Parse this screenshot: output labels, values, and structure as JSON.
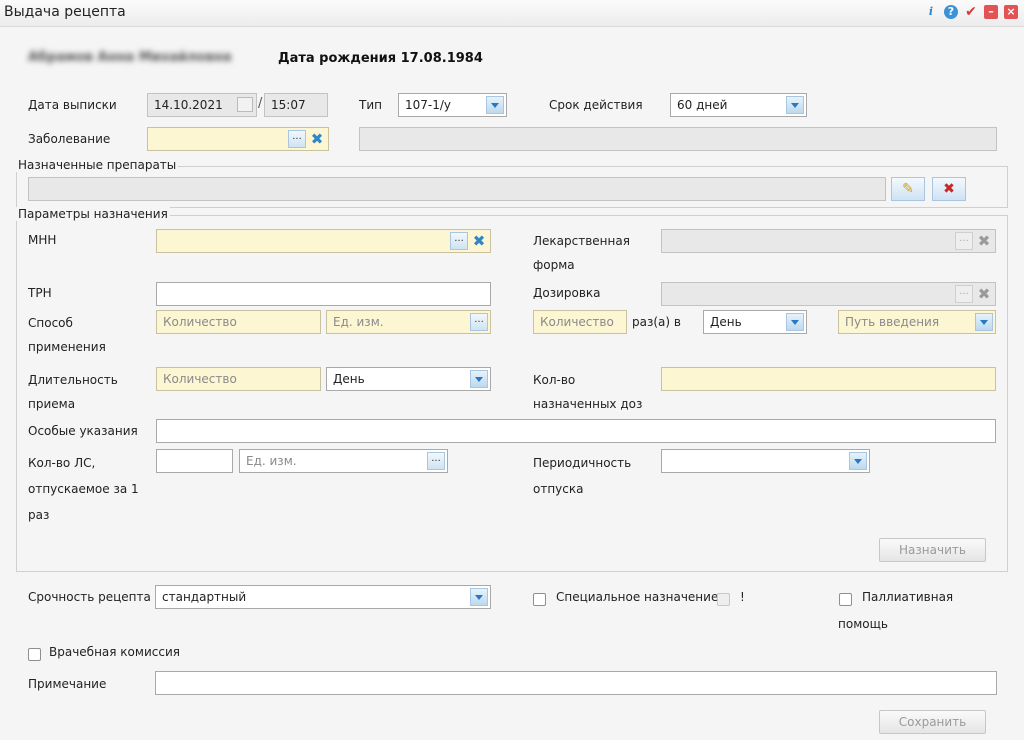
{
  "window": {
    "title": "Выдача рецепта"
  },
  "patient": {
    "name": "Абрамов Анна Михайловна",
    "dob_label": "Дата рождения 17.08.1984"
  },
  "form": {
    "issue_date_label": "Дата выписки",
    "issue_date": "14.10.2021",
    "issue_time": "15:07",
    "type_label": "Тип",
    "type_value": "107-1/у",
    "validity_label": "Срок действия",
    "validity_value": "60 дней",
    "disease_label": "Заболевание"
  },
  "prescribed": {
    "legend": "Назначенные препараты"
  },
  "params": {
    "legend": "Параметры назначения",
    "mnn_label": "МНН",
    "dosage_form_label_1": "Лекарственная",
    "dosage_form_label_2": "форма",
    "trn_label": "ТРН",
    "dosage_label": "Дозировка",
    "method_label_1": "Способ",
    "method_label_2": "применения",
    "qty_placeholder": "Количество",
    "unit_placeholder": "Ед. изм.",
    "times_label": "раз(а) в",
    "period_value": "День",
    "route_placeholder": "Путь введения",
    "duration_label_1": "Длительность",
    "duration_label_2": "приема",
    "duration_unit": "День",
    "doses_label_1": "Кол-во",
    "doses_label_2": "назначенных доз",
    "special_label": "Особые указания",
    "dispense_label_1": "Кол-во ЛС,",
    "dispense_label_2": "отпускаемое за 1",
    "dispense_label_3": "раз",
    "periodicity_label_1": "Периодичность",
    "periodicity_label_2": "отпуска",
    "assign_button": "Назначить"
  },
  "bottom": {
    "urgency_label": "Срочность рецепта",
    "urgency_value": "стандартный",
    "special_purpose_label": "Специальное назначение",
    "exclamation": "!",
    "palliative_label_1": "Паллиативная",
    "palliative_label_2": "помощь",
    "commission_label": "Врачебная комиссия",
    "note_label": "Примечание",
    "save_button": "Сохранить"
  },
  "icons": [
    "info-icon",
    "help-icon",
    "check-icon",
    "minimize-icon",
    "close-icon",
    "calendar-icon",
    "pencil-icon",
    "delete-icon"
  ],
  "colors": {
    "required_field": "#fdf6d3",
    "accent": "#2679c2",
    "close": "#e25454",
    "check": "#d53b3b"
  }
}
